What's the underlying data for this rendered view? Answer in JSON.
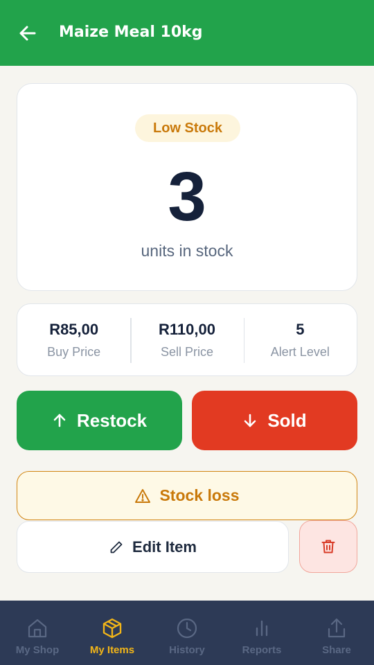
{
  "header": {
    "title": "Maize Meal 10kg",
    "background_color": "#22a34b",
    "back_icon": "arrow-left-icon"
  },
  "stock": {
    "status": "Low Stock",
    "status_color": "#c9790a",
    "count": "3",
    "unit_label": "units in stock"
  },
  "prices": [
    {
      "value": "R85,00",
      "label": "Buy Price"
    },
    {
      "value": "R110,00",
      "label": "Sell Price"
    },
    {
      "value": "5",
      "label": "Alert Level"
    }
  ],
  "actions": {
    "restock_label": "Restock",
    "restock_icon": "arrow-up-icon",
    "restock_color": "#22a34b",
    "sold_label": "Sold",
    "sold_icon": "arrow-down-icon",
    "sold_color": "#e23a22",
    "loss_label": "Stock loss",
    "loss_icon": "warning-icon",
    "edit_label": "Edit Item",
    "edit_icon": "pencil-icon",
    "delete_icon": "trash-icon"
  },
  "nav": {
    "active_color": "#f2b518",
    "items": [
      {
        "label": "My Shop",
        "icon": "home-icon",
        "active": false
      },
      {
        "label": "My Items",
        "icon": "box-icon",
        "active": true
      },
      {
        "label": "History",
        "icon": "clock-icon",
        "active": false
      },
      {
        "label": "Reports",
        "icon": "bar-chart-icon",
        "active": false
      },
      {
        "label": "Share",
        "icon": "share-icon",
        "active": false
      }
    ]
  }
}
